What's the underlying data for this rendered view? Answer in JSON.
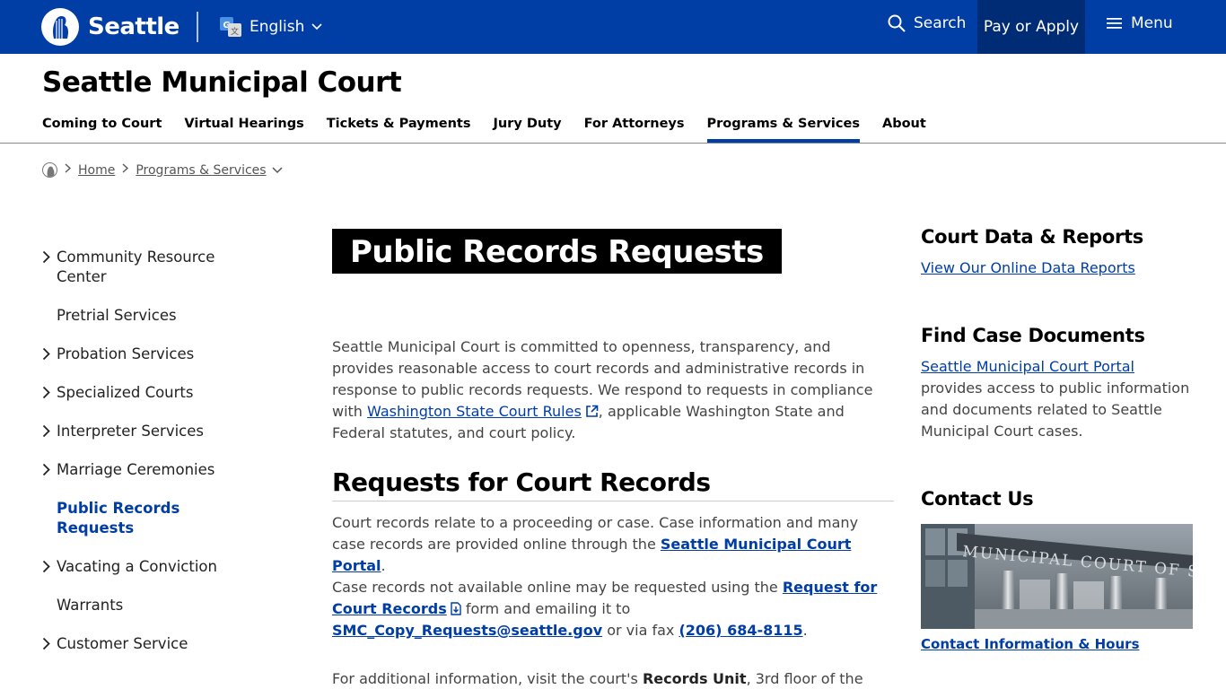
{
  "topbar": {
    "logo_text": "Seattle",
    "language": "English",
    "search_label": "Search",
    "pay_label": "Pay or Apply",
    "menu_label": "Menu",
    "colors": {
      "bar": "#003da5",
      "pay_bg": "#002b75"
    }
  },
  "site": {
    "title": "Seattle Municipal Court",
    "nav": [
      {
        "label": "Coming to Court"
      },
      {
        "label": "Virtual Hearings"
      },
      {
        "label": "Tickets & Payments"
      },
      {
        "label": "Jury Duty"
      },
      {
        "label": "For Attorneys"
      },
      {
        "label": "Programs & Services",
        "active": true
      },
      {
        "label": "About"
      }
    ]
  },
  "breadcrumb": {
    "home": "Home",
    "section": "Programs & Services"
  },
  "sidenav": {
    "items": [
      {
        "label": "Community Resource Center",
        "expandable": true
      },
      {
        "label": "Pretrial Services",
        "expandable": false
      },
      {
        "label": "Probation Services",
        "expandable": true
      },
      {
        "label": "Specialized Courts",
        "expandable": true
      },
      {
        "label": "Interpreter Services",
        "expandable": true
      },
      {
        "label": "Marriage Ceremonies",
        "expandable": true
      },
      {
        "label": "Public Records Requests",
        "expandable": false,
        "current": true
      },
      {
        "label": "Vacating a Conviction",
        "expandable": true
      },
      {
        "label": "Warrants",
        "expandable": false
      },
      {
        "label": "Customer Service",
        "expandable": true
      }
    ]
  },
  "main": {
    "title": "Public Records Requests",
    "intro": {
      "p1": "Seattle Municipal Court is committed to openness, transparency, and provides reasonable access to court records and administrative records in response to public records requests. We respond to requests in compliance with ",
      "link": "Washington State Court Rules",
      "p2": ", applicable Washington State and Federal statutes, and court policy."
    },
    "h2": "Requests for Court Records",
    "para1": {
      "text": "Court records relate to a proceeding or case. Case information and many case records are provided online through the ",
      "link": "Seattle Municipal Court Portal",
      "end": "."
    },
    "para2": {
      "t1": "Case records not available online may be requested using the ",
      "link1": "Request for Court Records",
      "t2": " form and emailing it to ",
      "email": "SMC_Copy_Requests@seattle.gov",
      "t3": " or via fax ",
      "phone": "(206) 684-8115",
      "t4": "."
    },
    "para3": {
      "t1": "For additional information, visit the court's ",
      "bold": "Records Unit",
      "t2": ", 3rd floor of the"
    }
  },
  "right": {
    "data_title": "Court Data & Reports",
    "data_link": "View Our Online Data Reports",
    "docs_title": "Find Case Documents",
    "docs_link": "Seattle Municipal Court Portal",
    "docs_text": " provides access to public information and documents related to Seattle Municipal Court cases.",
    "contact_title": "Contact Us",
    "contact_link": "Contact Information & Hours",
    "image_sign": "MUNICIPAL COURT OF SEATTLE"
  }
}
